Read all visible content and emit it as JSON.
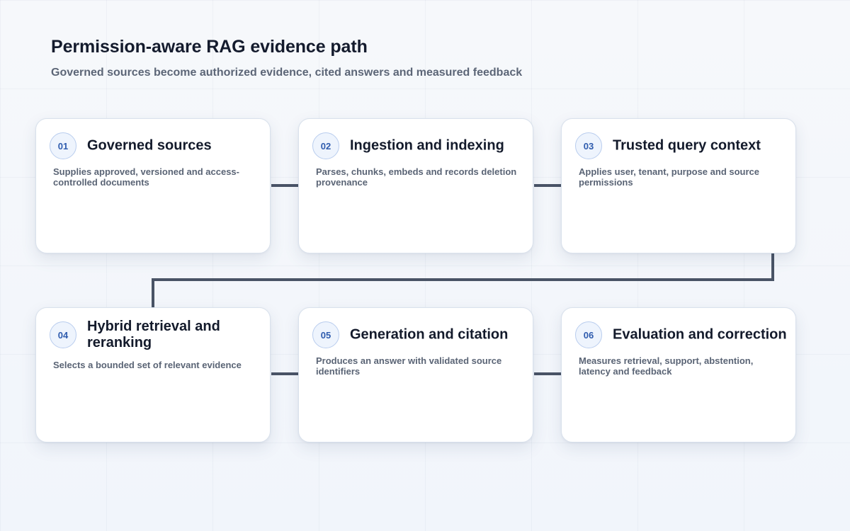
{
  "title": "Permission-aware RAG evidence path",
  "subtitle": "Governed sources become authorized evidence, cited answers and measured feedback",
  "colors": {
    "connector": "#4a5466",
    "badge_text": "#2f5cae",
    "badge_border": "#b9cdee",
    "card_background": "#ffffff"
  },
  "steps": [
    {
      "number": "01",
      "title": "Governed sources",
      "description": "Supplies approved, versioned and access-controlled documents"
    },
    {
      "number": "02",
      "title": "Ingestion and indexing",
      "description": "Parses, chunks, embeds and records deletion provenance"
    },
    {
      "number": "03",
      "title": "Trusted query context",
      "description": "Applies user, tenant, purpose and source permissions"
    },
    {
      "number": "04",
      "title": "Hybrid retrieval and reranking",
      "description": "Selects a bounded set of relevant evidence"
    },
    {
      "number": "05",
      "title": "Generation and citation",
      "description": "Produces an answer with validated source identifiers"
    },
    {
      "number": "06",
      "title": "Evaluation and correction",
      "description": "Measures retrieval, support, abstention, latency and feedback"
    }
  ]
}
